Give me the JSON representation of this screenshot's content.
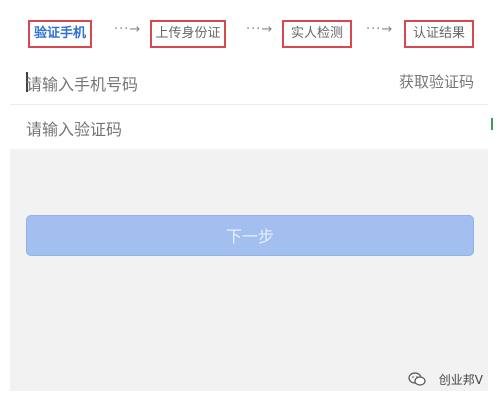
{
  "steps": [
    {
      "label": "验证手机"
    },
    {
      "label": "上传身份证"
    },
    {
      "label": "实人检测"
    },
    {
      "label": "认证结果"
    }
  ],
  "separator": "···→",
  "form": {
    "phone_placeholder": "请输入手机号码",
    "get_code_label": "获取验证码",
    "code_placeholder": "请输入验证码"
  },
  "next_button_label": "下一步",
  "watermark_text": "创业邦V",
  "colors": {
    "step_border": "#d9484f",
    "active_step": "#2f6fd6",
    "button_bg": "#a3bff0",
    "page_bg": "#f2f2f2"
  }
}
